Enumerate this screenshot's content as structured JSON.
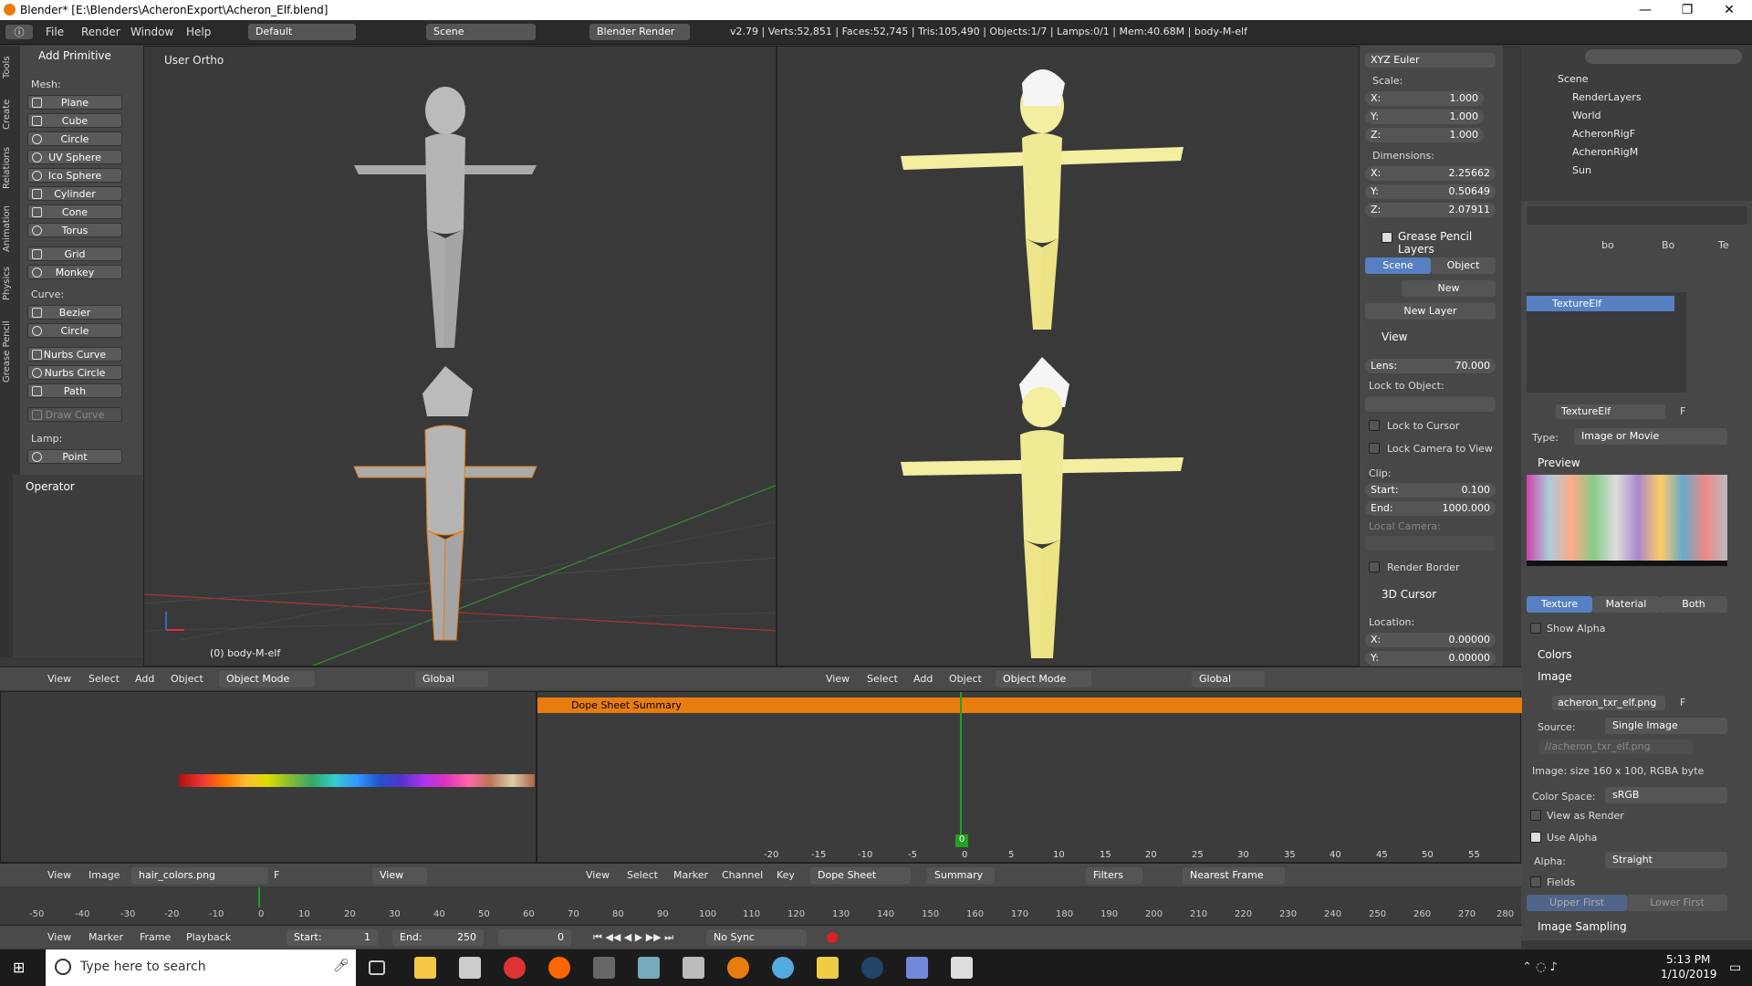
{
  "window": {
    "title": "Blender* [E:\\Blenders\\AcheronExport\\Acheron_Elf.blend]",
    "minimize": "—",
    "maximize": "❐",
    "close": "✕"
  },
  "infobar": {
    "menus": [
      "File",
      "Render",
      "Window",
      "Help"
    ],
    "layout": "Default",
    "scene": "Scene",
    "engine": "Blender Render",
    "stats": "v2.79 | Verts:52,851 | Faces:52,745 | Tris:105,490 | Objects:1/7 | Lamps:0/1 | Mem:40.68M | body-M-elf"
  },
  "vtabs": [
    "Tools",
    "Create",
    "Relations",
    "Animation",
    "Physics",
    "Grease Pencil"
  ],
  "toolshelf": {
    "header": "Add Primitive",
    "mesh_label": "Mesh:",
    "mesh": [
      "Plane",
      "Cube",
      "Circle",
      "UV Sphere",
      "Ico Sphere",
      "Cylinder",
      "Cone",
      "Torus"
    ],
    "grid": "Grid",
    "monkey": "Monkey",
    "curve_label": "Curve:",
    "curve": [
      "Bezier",
      "Circle"
    ],
    "nurbs": [
      "Nurbs Curve",
      "Nurbs Circle",
      "Path"
    ],
    "draw_curve": "Draw Curve",
    "lamp_label": "Lamp:",
    "point": "Point",
    "operator": "Operator"
  },
  "viewport_left": {
    "label": "User Ortho",
    "object_label": "(0) body-M-elf",
    "menus": [
      "View",
      "Select",
      "Add",
      "Object"
    ],
    "mode": "Object Mode",
    "orientation": "Global"
  },
  "viewport_right": {
    "menus": [
      "View",
      "Select",
      "Add",
      "Object"
    ],
    "mode": "Object Mode",
    "orientation": "Global"
  },
  "npanel": {
    "rotation_mode": "XYZ Euler",
    "scale_label": "Scale:",
    "scale": [
      {
        "axis": "X:",
        "value": "1.000"
      },
      {
        "axis": "Y:",
        "value": "1.000"
      },
      {
        "axis": "Z:",
        "value": "1.000"
      }
    ],
    "dimensions_label": "Dimensions:",
    "dimensions": [
      {
        "axis": "X:",
        "value": "2.25662"
      },
      {
        "axis": "Y:",
        "value": "0.50649"
      },
      {
        "axis": "Z:",
        "value": "2.07911"
      }
    ],
    "grease_header": "Grease Pencil Layers",
    "scene_btn": "Scene",
    "object_btn": "Object",
    "new_btn": "New",
    "new_layer_btn": "New Layer",
    "view_header": "View",
    "lens_label": "Lens:",
    "lens_value": "70.000",
    "lock_obj_label": "Lock to Object:",
    "lock_cursor": "Lock to Cursor",
    "lock_camera": "Lock Camera to View",
    "clip_label": "Clip:",
    "clip_start_label": "Start:",
    "clip_start": "0.100",
    "clip_end_label": "End:",
    "clip_end": "1000.000",
    "local_camera": "Local Camera:",
    "render_border": "Render Border",
    "cursor_header": "3D Cursor",
    "location_label": "Location:",
    "cursor_x": "0.00000",
    "cursor_y": "0.00000",
    "x_lbl": "X:",
    "y_lbl": "Y:"
  },
  "outliner": {
    "rows": [
      "Scene",
      "RenderLayers",
      "World",
      "AcheronRigF",
      "AcheronRigM",
      "Sun"
    ]
  },
  "props": {
    "crumbs": [
      "bo",
      "Bo",
      "Te"
    ],
    "texture_slot": "TextureElf",
    "texture_name": "TextureElf",
    "f_label": "F",
    "type_label": "Type:",
    "type_value": "Image or Movie",
    "preview_header": "Preview",
    "tab_texture": "Texture",
    "tab_material": "Material",
    "tab_both": "Both",
    "show_alpha": "Show Alpha",
    "colors_header": "Colors",
    "image_header": "Image",
    "image_name": "acheron_txr_elf.png",
    "source_label": "Source:",
    "source_value": "Single Image",
    "image_path": "//acheron_txr_elf.png",
    "image_info": "Image: size 160 x 100, RGBA byte",
    "colorspace_label": "Color Space:",
    "colorspace_value": "sRGB",
    "view_as_render": "View as Render",
    "use_alpha": "Use Alpha",
    "alpha_label": "Alpha:",
    "alpha_value": "Straight",
    "fields": "Fields",
    "upper_first": "Upper First",
    "lower_first": "Lower First",
    "image_sampling": "Image Sampling"
  },
  "image_editor": {
    "menus": [
      "View",
      "Image"
    ],
    "image_name": "hair_colors.png",
    "f_label": "F",
    "view_dd": "View"
  },
  "dopesheet": {
    "summary": "Dope Sheet Summary",
    "ticks": [
      "-20",
      "-15",
      "-10",
      "-5",
      "0",
      "5",
      "10",
      "15",
      "20",
      "25",
      "30",
      "35",
      "40",
      "45",
      "50",
      "55"
    ],
    "current_frame": "0",
    "menus": [
      "View",
      "Select",
      "Marker",
      "Channel",
      "Key"
    ],
    "mode": "Dope Sheet",
    "summary_btn": "Summary",
    "filters": "Filters",
    "snap": "Nearest Frame"
  },
  "timeline": {
    "ticks": [
      "-50",
      "-40",
      "-30",
      "-20",
      "-10",
      "0",
      "10",
      "20",
      "30",
      "40",
      "50",
      "60",
      "70",
      "80",
      "90",
      "100",
      "110",
      "120",
      "130",
      "140",
      "150",
      "160",
      "170",
      "180",
      "190",
      "200",
      "210",
      "220",
      "230",
      "240",
      "250",
      "260",
      "270",
      "280"
    ],
    "menus": [
      "View",
      "Marker",
      "Frame",
      "Playback"
    ],
    "start_label": "Start:",
    "start": "1",
    "end_label": "End:",
    "end": "250",
    "frame": "0",
    "sync": "No Sync"
  },
  "taskbar": {
    "search": "Type here to search",
    "time": "5:13 PM",
    "date": "1/10/2019"
  },
  "colors": {
    "accent_orange": "#e87d0d",
    "select_blue": "#5680c2",
    "frame_green": "#22a022",
    "skin_yellow": "#f3eea0"
  }
}
